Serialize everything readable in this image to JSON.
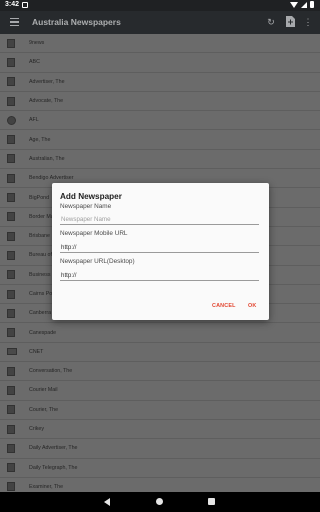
{
  "status_bar": {
    "time": "3:42"
  },
  "app_bar": {
    "title": "Australia Newspapers",
    "menu_icon": "menu-icon",
    "refresh_icon": "refresh-icon",
    "add_icon": "add-document-icon",
    "more_icon": "more-vert-icon"
  },
  "list": {
    "items": [
      {
        "label": "9news",
        "icon": "newspaper-icon"
      },
      {
        "label": "ABC",
        "icon": "newspaper-icon"
      },
      {
        "label": "Advertiser, The",
        "icon": "newspaper-icon"
      },
      {
        "label": "Advocate, The",
        "icon": "newspaper-icon"
      },
      {
        "label": "AFL",
        "icon": "football-icon"
      },
      {
        "label": "Age, The",
        "icon": "newspaper-icon"
      },
      {
        "label": "Australian, The",
        "icon": "newspaper-icon"
      },
      {
        "label": "Bendigo Advertiser",
        "icon": "newspaper-icon"
      },
      {
        "label": "BigPond",
        "icon": "newspaper-icon"
      },
      {
        "label": "Border Mail",
        "icon": "newspaper-icon"
      },
      {
        "label": "Brisbane",
        "icon": "newspaper-icon"
      },
      {
        "label": "Bureau of",
        "icon": "newspaper-icon"
      },
      {
        "label": "Business",
        "icon": "newspaper-icon"
      },
      {
        "label": "Cairns Post",
        "icon": "newspaper-icon"
      },
      {
        "label": "Canberra",
        "icon": "newspaper-icon"
      },
      {
        "label": "Canespade",
        "icon": "newspaper-icon"
      },
      {
        "label": "CNET",
        "icon": "monitor-icon"
      },
      {
        "label": "Conversation, The",
        "icon": "newspaper-icon"
      },
      {
        "label": "Courier Mail",
        "icon": "newspaper-icon"
      },
      {
        "label": "Courier, The",
        "icon": "newspaper-icon"
      },
      {
        "label": "Crikey",
        "icon": "newspaper-icon"
      },
      {
        "label": "Daily Advertiser, The",
        "icon": "newspaper-icon"
      },
      {
        "label": "Daily Telegraph, The",
        "icon": "newspaper-icon"
      },
      {
        "label": "Examiner, The",
        "icon": "newspaper-icon"
      }
    ]
  },
  "dialog": {
    "title": "Add Newspaper",
    "name_label": "Newspaper Name",
    "name_placeholder": "Newspaper Name",
    "mobile_label": "Newspaper Mobile URL",
    "mobile_value": "http://",
    "desktop_label": "Newspaper URL(Desktop)",
    "desktop_value": "http://",
    "cancel_label": "CANCEL",
    "ok_label": "OK"
  },
  "nav_bar": {
    "back_icon": "back-icon",
    "home_icon": "home-icon",
    "recents_icon": "recents-icon"
  },
  "colors": {
    "app_bar": "#2d3034",
    "accent": "#e2452f",
    "list_bg": "#7a7a7a"
  }
}
